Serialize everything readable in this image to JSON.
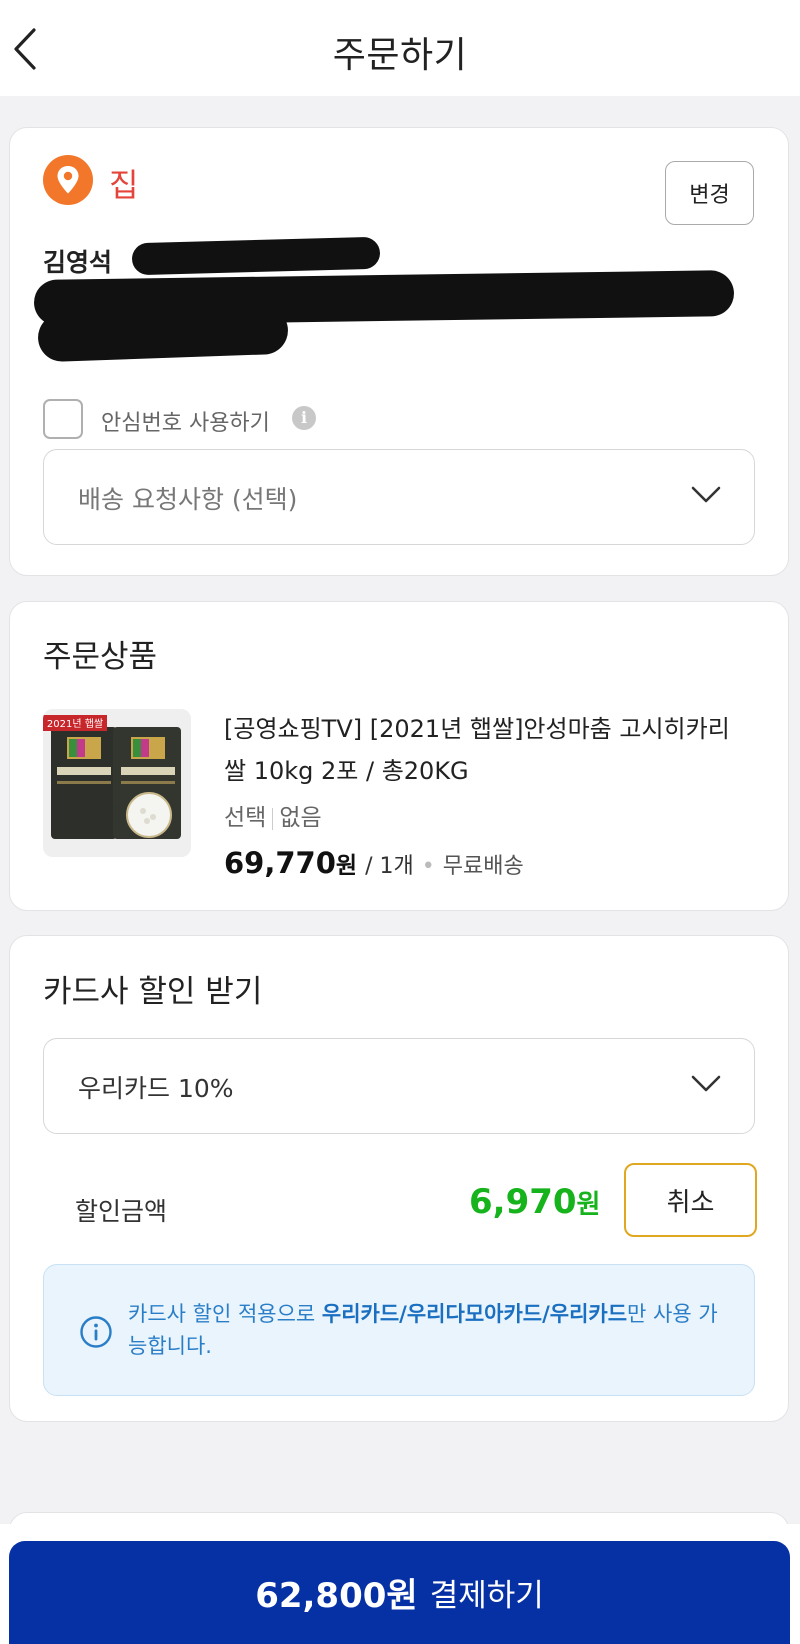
{
  "header": {
    "title": "주문하기",
    "back_icon": "chevron-left-icon"
  },
  "address": {
    "label": "집",
    "label_color": "#e4453a",
    "pin_color": "#f2772b",
    "change_button": "변경",
    "recipient_name": "김영석",
    "safe_number_label": "안심번호 사용하기",
    "safe_number_checked": false,
    "delivery_request_placeholder": "배송 요청사항 (선택)"
  },
  "order": {
    "title": "주문상품",
    "product_name": "[공영쇼핑TV] [2021년 햅쌀]안성마춤 고시히카리쌀 10kg 2포 / 총20KG",
    "thumbnail_badge": "2021년 햅쌀",
    "option_label": "선택",
    "option_value": "없음",
    "price": "69,770",
    "price_unit": "원",
    "quantity": "/ 1개",
    "shipping": "무료배송"
  },
  "card_discount": {
    "title": "카드사 할인 받기",
    "selected_card": "우리카드 10%",
    "discount_label": "할인금액",
    "discount_amount": "6,970",
    "discount_unit": "원",
    "cancel_button": "취소",
    "notice_prefix": "카드사 할인 적용으로 ",
    "notice_cards": "우리카드/우리다모아카드/우리카드",
    "notice_suffix": "만 사용 가능합니다.",
    "accent_green": "#16b31c",
    "notice_blue": "#2a7ec7"
  },
  "checkout": {
    "amount": "62,800원",
    "label": "결제하기",
    "button_color": "#0631a5"
  }
}
